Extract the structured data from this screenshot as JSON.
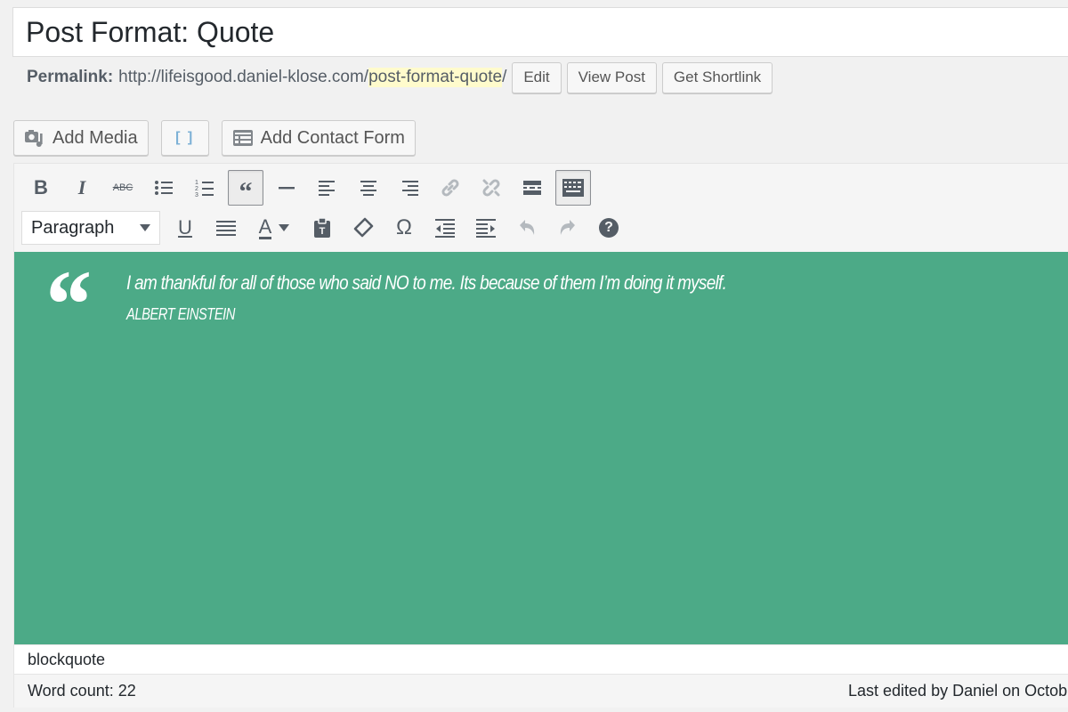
{
  "title": {
    "value": "Post Format: Quote"
  },
  "permalink": {
    "label": "Permalink:",
    "base": "http://lifeisgood.daniel-klose.com/",
    "slug": "post-format-quote",
    "trail": "/",
    "buttons": [
      "Edit",
      "View Post",
      "Get Shortlink"
    ]
  },
  "media_buttons": {
    "add_media": "Add Media",
    "shortcode": "[ ]",
    "add_contact_form": "Add Contact Form"
  },
  "toolbar": {
    "format_select": "Paragraph",
    "row1": [
      {
        "name": "bold",
        "label": "B"
      },
      {
        "name": "italic",
        "label": "I"
      },
      {
        "name": "strikethrough",
        "label": "ABC"
      },
      {
        "name": "bulleted-list"
      },
      {
        "name": "numbered-list"
      },
      {
        "name": "blockquote",
        "active": true
      },
      {
        "name": "horizontal-line"
      },
      {
        "name": "align-left"
      },
      {
        "name": "align-center"
      },
      {
        "name": "align-right"
      },
      {
        "name": "insert-link"
      },
      {
        "name": "remove-link"
      },
      {
        "name": "read-more"
      },
      {
        "name": "toolbar-toggle",
        "active": true
      }
    ],
    "row2": [
      {
        "name": "underline",
        "label": "U"
      },
      {
        "name": "justify"
      },
      {
        "name": "text-color",
        "label": "A"
      },
      {
        "name": "paste-as-text"
      },
      {
        "name": "clear-formatting"
      },
      {
        "name": "special-character",
        "label": "Ω"
      },
      {
        "name": "outdent"
      },
      {
        "name": "indent"
      },
      {
        "name": "undo"
      },
      {
        "name": "redo"
      },
      {
        "name": "help",
        "label": "?"
      }
    ]
  },
  "content": {
    "background": "#4caa87",
    "quote_mark": "“",
    "quote": "I am thankful for all of those who said NO to me. Its because of them I’m doing it myself.",
    "cite": "ALBERT EINSTEIN"
  },
  "status": {
    "path": "blockquote"
  },
  "footer": {
    "word_count": "Word count: 22",
    "last_edited": "Last edited by Daniel on Octob"
  }
}
